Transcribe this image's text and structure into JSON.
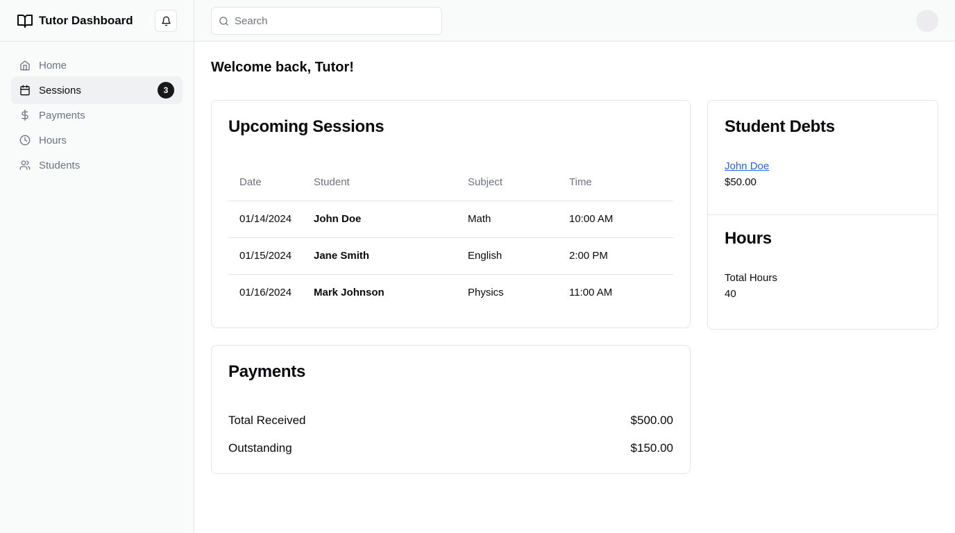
{
  "app": {
    "title": "Tutor Dashboard"
  },
  "icons": {
    "brand": "book-open-icon",
    "bell": "bell-icon",
    "search": "search-icon"
  },
  "sidebar": {
    "items": [
      {
        "label": "Home",
        "icon": "home-icon"
      },
      {
        "label": "Sessions",
        "icon": "calendar-icon",
        "badge": "3",
        "active": true
      },
      {
        "label": "Payments",
        "icon": "dollar-icon"
      },
      {
        "label": "Hours",
        "icon": "clock-icon"
      },
      {
        "label": "Students",
        "icon": "users-icon"
      }
    ]
  },
  "search": {
    "placeholder": "Search",
    "value": ""
  },
  "welcome": "Welcome back, Tutor!",
  "sessions": {
    "title": "Upcoming Sessions",
    "headers": [
      "Date",
      "Student",
      "Subject",
      "Time"
    ],
    "rows": [
      {
        "date": "01/14/2024",
        "student": "John Doe",
        "subject": "Math",
        "time": "10:00 AM"
      },
      {
        "date": "01/15/2024",
        "student": "Jane Smith",
        "subject": "English",
        "time": "2:00 PM"
      },
      {
        "date": "01/16/2024",
        "student": "Mark Johnson",
        "subject": "Physics",
        "time": "11:00 AM"
      }
    ]
  },
  "payments": {
    "title": "Payments",
    "total_label": "Total Received",
    "total_value": "$500.00",
    "outstanding_label": "Outstanding",
    "outstanding_value": "$150.00"
  },
  "debts": {
    "title": "Student Debts",
    "student": "John Doe",
    "amount": "$50.00"
  },
  "hours": {
    "title": "Hours",
    "label": "Total Hours",
    "value": "40"
  },
  "colors": {
    "accent": "#18181b",
    "link": "#2563eb",
    "sidebar_bg": "#f9fafa",
    "border": "#e4e4e7"
  }
}
